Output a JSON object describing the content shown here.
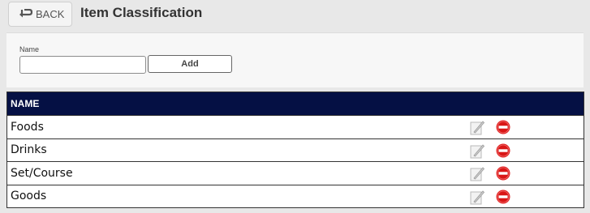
{
  "header": {
    "back_label": "BACK",
    "title": "Item Classification"
  },
  "form": {
    "name_label": "Name",
    "name_value": "",
    "add_label": "Add"
  },
  "table": {
    "column_header": "NAME",
    "rows": [
      {
        "name": "Foods"
      },
      {
        "name": "Drinks"
      },
      {
        "name": "Set/Course"
      },
      {
        "name": "Goods"
      }
    ]
  },
  "icons": {
    "back": "back-arrow-icon",
    "edit": "edit-icon",
    "delete": "delete-icon"
  },
  "colors": {
    "table_header_bg": "#051044",
    "delete_red": "#e02020"
  }
}
